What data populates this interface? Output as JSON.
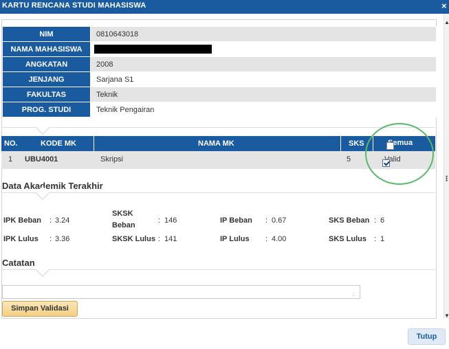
{
  "window": {
    "title": "KARTU RENCANA STUDI MAHASISWA",
    "close_glyph": "×"
  },
  "student": {
    "rows": [
      {
        "label": "NIM",
        "value": "0810643018"
      },
      {
        "label": "NAMA MAHASISWA",
        "value": ""
      },
      {
        "label": "ANGKATAN",
        "value": "2008"
      },
      {
        "label": "JENJANG",
        "value": "Sarjana S1"
      },
      {
        "label": "FAKULTAS",
        "value": "Teknik"
      },
      {
        "label": "PROG. STUDI",
        "value": "Teknik Pengairan"
      }
    ]
  },
  "courses": {
    "headers": {
      "no": "NO.",
      "kode": "KODE MK",
      "nama": "NAMA MK",
      "sks": "SKS",
      "semua": "Semua"
    },
    "select_all_checked": false,
    "rows": [
      {
        "no": "1",
        "kode": "UBU4001",
        "nama": "Skripsi",
        "sks": "5",
        "valid_label": "Valid",
        "valid_checked": true
      }
    ]
  },
  "akademik": {
    "title": "Data Akademik Terakhir",
    "ipk_beban_label": "IPK Beban",
    "ipk_beban_value": "3.24",
    "sksk_beban_label_1": "SKSK",
    "sksk_beban_label_2": "Beban",
    "sksk_beban_value": "146",
    "ip_beban_label": "IP Beban",
    "ip_beban_value": "0.67",
    "sks_beban_label": "SKS Beban",
    "sks_beban_value": "6",
    "ipk_lulus_label": "IPK Lulus",
    "ipk_lulus_value": "3.36",
    "sksk_lulus_label": "SKSK Lulus",
    "sksk_lulus_value": "141",
    "ip_lulus_label": "IP Lulus",
    "ip_lulus_value": "4.00",
    "sks_lulus_label": "SKS Lulus",
    "sks_lulus_value": "1",
    "colon": ":"
  },
  "catatan": {
    "title": "Catatan",
    "value": ""
  },
  "buttons": {
    "save": "Simpan Validasi",
    "close": "Tutup"
  },
  "colors": {
    "header_blue": "#1a5a9e",
    "highlight_circle": "#5ab86a",
    "save_button": "#f3cf84"
  }
}
